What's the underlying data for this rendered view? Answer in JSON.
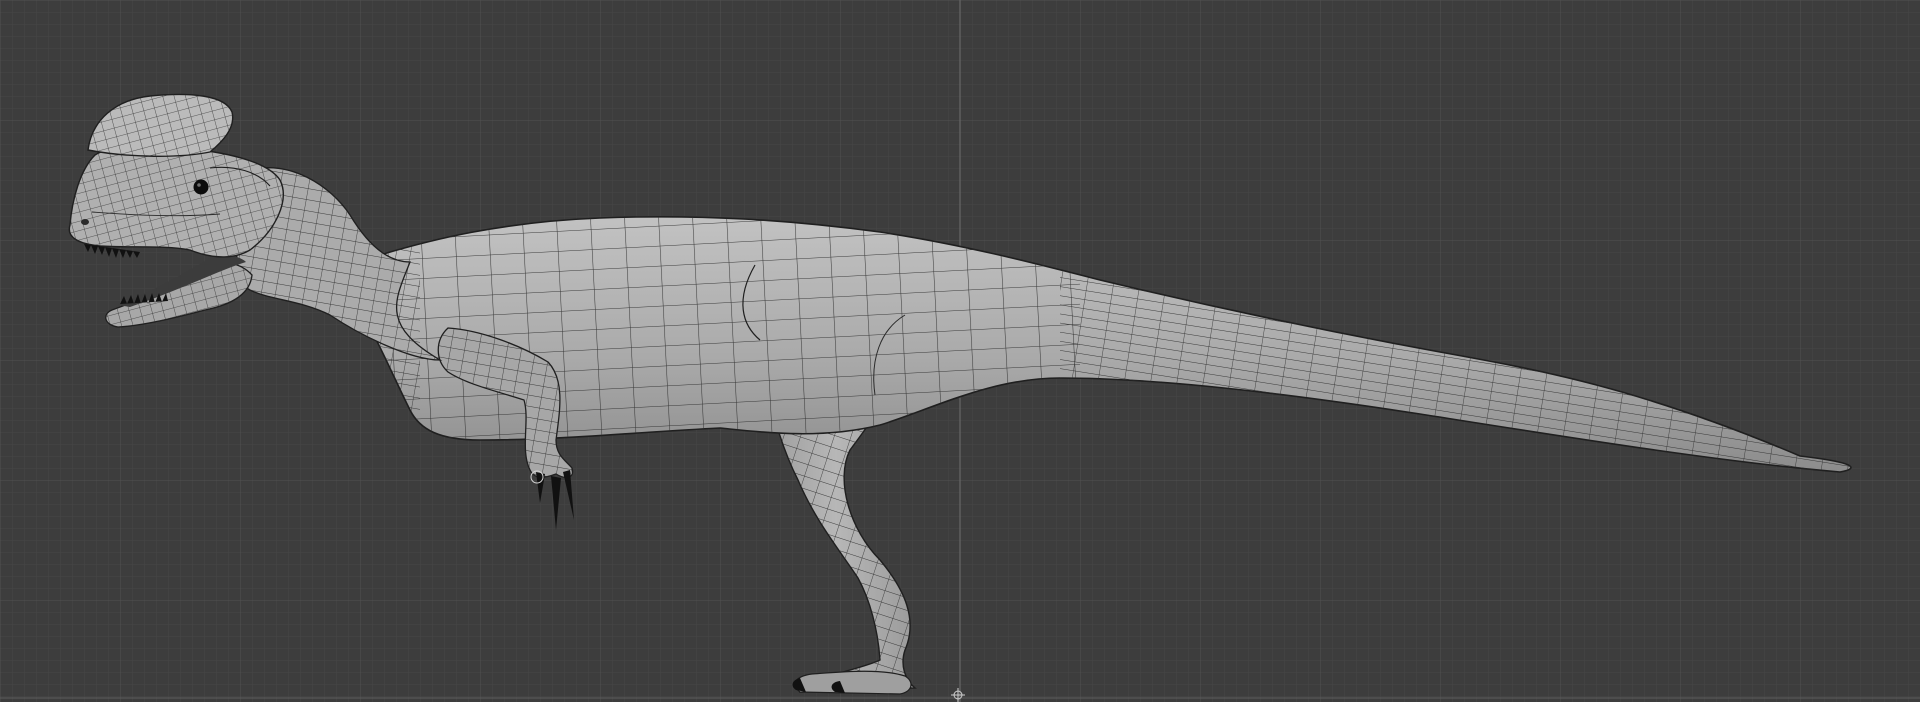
{
  "viewport": {
    "mode": "orthographic-side-view",
    "shading": "solid-wireframe-overlay",
    "colors": {
      "background": "#3d3d3d",
      "grid_minor": "#474747",
      "grid_major": "#525252",
      "axis_line": "#6a6a6a",
      "mesh_fill": "#a9a9a9",
      "mesh_shadow": "#8a8a8a",
      "mesh_highlight": "#c4c4c4",
      "wire": "#2e2e2e",
      "outline": "#1f1f1f",
      "claw": "#111111"
    }
  },
  "scene": {
    "object": "dinosaur-base-mesh",
    "icons": [
      "3d-cursor-icon"
    ]
  }
}
